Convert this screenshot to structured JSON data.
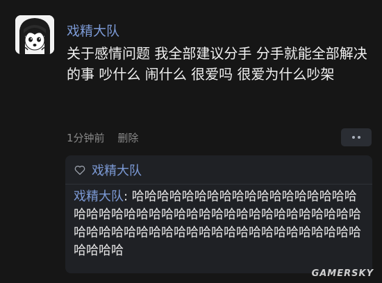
{
  "post": {
    "username": "戏精大队",
    "text": "关于感情问题 我全部建议分手 分手就能全部解决的事 吵什么 闹什么 很爱吗 很爱为什么吵架",
    "time": "1分钟前",
    "delete_label": "删除",
    "avatar_icon": "anime-girl-avatar"
  },
  "reply_box": {
    "like_icon": "heart-outline-icon",
    "liked_by": "戏精大队",
    "reply_author": "戏精大队",
    "reply_separator": ": ",
    "reply_text": "哈哈哈哈哈哈哈哈哈哈哈哈哈哈哈哈哈哈哈哈哈哈哈哈哈哈哈哈哈哈哈哈哈哈哈哈哈哈哈哈哈哈哈哈哈哈哈哈哈哈哈哈哈哈哈哈哈哈哈哈哈哈哈哈哈哈哈哈"
  },
  "watermark": "GAMERSKY",
  "colors": {
    "background": "#161616",
    "username": "#7c9ad6",
    "meta_text": "#8a8a8a",
    "reply_box": "#1f2125"
  }
}
